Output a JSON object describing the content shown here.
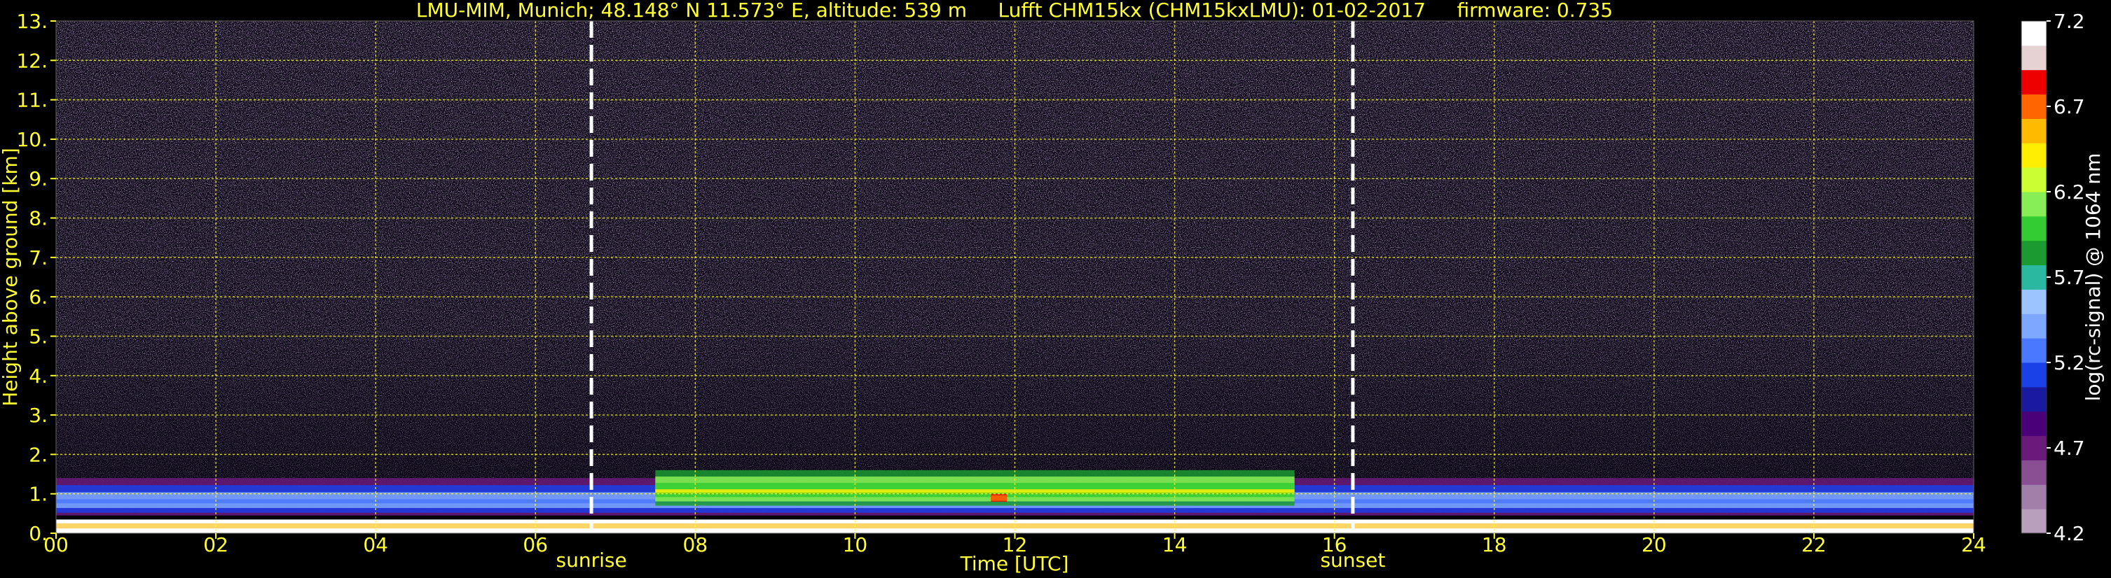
{
  "chart_data": {
    "type": "heatmap",
    "title": "LMU-MIM, Munich; 48.148° N 11.573° E, altitude: 539 m     Lufft CHM15kx (CHM15kxLMU): 01-02-2017     firmware: 0.735",
    "xlabel": "Time [UTC]",
    "ylabel": "Height above ground [km]",
    "x_ticks": [
      "00",
      "02",
      "04",
      "06",
      "08",
      "10",
      "12",
      "14",
      "16",
      "18",
      "20",
      "22",
      "24"
    ],
    "y_ticks": [
      "0.",
      "1.",
      "2.",
      "3.",
      "4.",
      "5.",
      "6.",
      "7.",
      "8.",
      "9.",
      "10.",
      "11.",
      "12.",
      "13."
    ],
    "xlim": [
      0,
      24
    ],
    "ylim": [
      0,
      13
    ],
    "grid": true,
    "events": [
      {
        "name": "sunrise",
        "time_utc": 6.7
      },
      {
        "name": "sunset",
        "time_utc": 16.23
      }
    ],
    "colorbar": {
      "label": "log(rc-signal) @ 1064 nm",
      "range": [
        4.2,
        7.2
      ],
      "ticks": [
        "4.2",
        "4.7",
        "5.2",
        "5.7",
        "6.2",
        "6.7",
        "7.2"
      ]
    },
    "layers": [
      {
        "feature": "boundary layer aerosol (blue/purple)",
        "time_start": 0,
        "time_end": 24,
        "base_km": 0.4,
        "top_km": 1.4
      },
      {
        "feature": "enhanced aerosol layer (green/yellow)",
        "time_start": 7.5,
        "time_end": 15.5,
        "base_km": 0.7,
        "top_km": 1.6
      },
      {
        "feature": "peak signal (red)",
        "time_start": 11.7,
        "time_end": 11.9,
        "base_km": 0.8,
        "top_km": 1.0
      }
    ]
  },
  "colors": {
    "text": "#ffff33",
    "grid": "#ffff33",
    "background": "#000000",
    "colorscale": [
      "#b8a0bc",
      "#a07fa9",
      "#8a4f93",
      "#6a1a7a",
      "#4a0078",
      "#1a1aa0",
      "#1a40e8",
      "#4a78ff",
      "#7ea8ff",
      "#9cc4ff",
      "#2ab8a0",
      "#1a9a30",
      "#33cc33",
      "#88ee55",
      "#ccff33",
      "#ffee00",
      "#ffbb00",
      "#ff6600",
      "#ee0000",
      "#e6d2d2",
      "#ffffff"
    ]
  }
}
